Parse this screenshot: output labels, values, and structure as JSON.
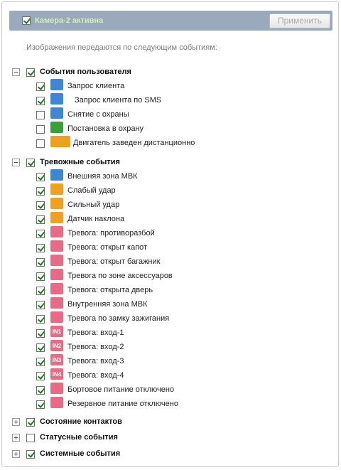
{
  "header": {
    "title": "Камера-2 активна",
    "apply_label": "Применить"
  },
  "subtitle": "Изображения передаются по следующим событиям:",
  "groups": [
    {
      "label": "События пользователя",
      "checked": true,
      "expanded": true,
      "items": [
        {
          "label": "Запрос клиента",
          "checked": true,
          "icon": "phone-icon",
          "color": "blue"
        },
        {
          "label": "Запрос клиента по SMS",
          "checked": true,
          "icon": "sms-icon",
          "color": "blue"
        },
        {
          "label": "Снятие с охраны",
          "checked": false,
          "icon": "unlock-icon",
          "color": "blue"
        },
        {
          "label": "Постановка в охрану",
          "checked": false,
          "icon": "lock-icon",
          "color": "green"
        },
        {
          "label": "Двигатель заведен дистанционно",
          "checked": false,
          "icon": "remote-engine-icon",
          "color": "orange"
        }
      ]
    },
    {
      "label": "Тревожные события",
      "checked": true,
      "expanded": true,
      "items": [
        {
          "label": "Внешняя зона МВК",
          "checked": true,
          "icon": "outer-zone-icon",
          "color": "blue"
        },
        {
          "label": "Слабый удар",
          "checked": true,
          "icon": "weak-hit-icon",
          "color": "orange"
        },
        {
          "label": "Сильный удар",
          "checked": true,
          "icon": "strong-hit-icon",
          "color": "orange"
        },
        {
          "label": "Датчик наклона",
          "checked": true,
          "icon": "tilt-sensor-icon",
          "color": "orange"
        },
        {
          "label": "Тревога: противоразбой",
          "checked": true,
          "icon": "anti-robbery-icon",
          "color": "pink"
        },
        {
          "label": "Тревога: открыт капот",
          "checked": true,
          "icon": "hood-open-icon",
          "color": "pink"
        },
        {
          "label": "Тревога: открыт багажник",
          "checked": true,
          "icon": "trunk-open-icon",
          "color": "pink"
        },
        {
          "label": "Тревога по зоне аксессуаров",
          "checked": true,
          "icon": "accessory-zone-icon",
          "color": "pink"
        },
        {
          "label": "Тревога: открыта дверь",
          "checked": true,
          "icon": "door-open-icon",
          "color": "pink"
        },
        {
          "label": "Внутренняя зона МВК",
          "checked": true,
          "icon": "inner-zone-icon",
          "color": "pink"
        },
        {
          "label": "Тревога по замку зажигания",
          "checked": true,
          "icon": "ignition-lock-icon",
          "color": "pink"
        },
        {
          "label": "Тревога: вход-1",
          "checked": true,
          "icon": "input-1-icon",
          "color": "pink",
          "text": "IN1"
        },
        {
          "label": "Тревога: вход-2",
          "checked": true,
          "icon": "input-2-icon",
          "color": "pink",
          "text": "IN2"
        },
        {
          "label": "Тревога: вход-3",
          "checked": true,
          "icon": "input-3-icon",
          "color": "pink",
          "text": "IN3"
        },
        {
          "label": "Тревога: вход-4",
          "checked": true,
          "icon": "input-4-icon",
          "color": "pink",
          "text": "IN4"
        },
        {
          "label": "Бортовое питание отключено",
          "checked": true,
          "icon": "main-power-off-icon",
          "color": "pink"
        },
        {
          "label": "Резервное питание отключено",
          "checked": true,
          "icon": "backup-power-off-icon",
          "color": "pink"
        }
      ]
    },
    {
      "label": "Состояние контактов",
      "checked": true,
      "expanded": false,
      "items": []
    },
    {
      "label": "Статусные события",
      "checked": false,
      "expanded": false,
      "items": []
    },
    {
      "label": "Системные события",
      "checked": true,
      "expanded": false,
      "items": []
    }
  ]
}
